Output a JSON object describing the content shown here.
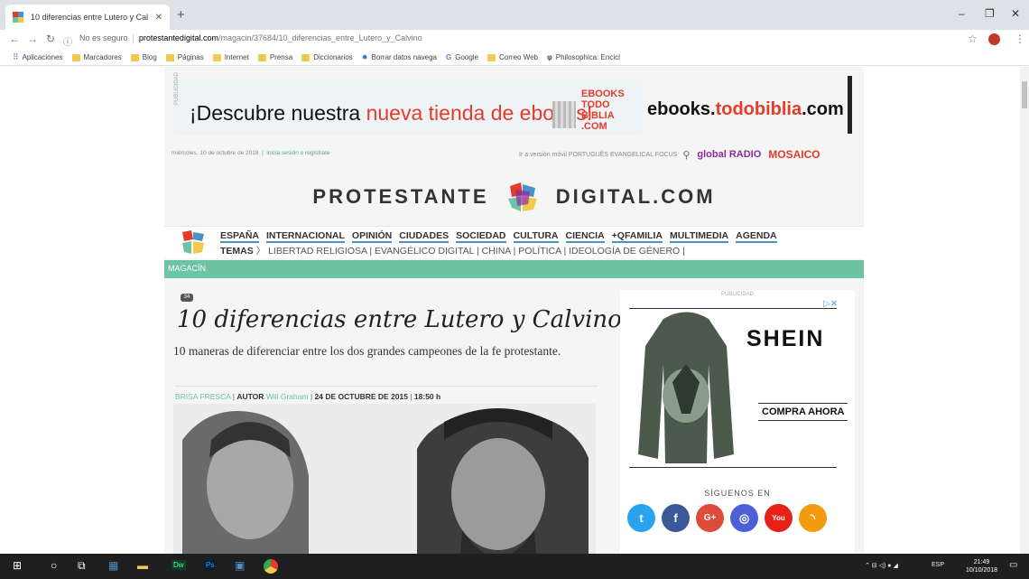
{
  "browser": {
    "tab_title": "10 diferencias entre Lutero y Cal",
    "address_secure": "No es seguro",
    "address_host": "protestantedigital.com",
    "address_path": "/magacin/37684/10_diferencias_entre_Lutero_y_Calvino",
    "bookmarks": [
      "Aplicaciones",
      "Marcadores",
      "Blog",
      "Páginas",
      "Internet",
      "Prensa",
      "Diccionarios",
      "Borrar datos navega",
      "Google",
      "Correo Web",
      "Philosophica: Encicl"
    ]
  },
  "banner": {
    "publicidad": "PUBLICIDAD",
    "text_start": "¡Descubre nuestra ",
    "text_red": "nueva tienda de ebooks!",
    "todobiblia": "EBOOKS TODO BIBLIA .COM",
    "url_black": "ebooks.",
    "url_red": "todobiblia",
    "url_end": ".com"
  },
  "meta": {
    "date": "miércoles, 10 de octubre de 2018",
    "login": "inicia sesión o regístrate",
    "right_links": "Ir a versión móvil   PORTUGUÊS   EVANGELICAL FOCUS",
    "global": "global RADIO",
    "mosaico": "MOSAICO"
  },
  "logo": {
    "left": "PROTESTANTE",
    "right": "DIGITAL.COM"
  },
  "menu": {
    "items": [
      "ESPAÑA",
      "INTERNACIONAL",
      "OPINIÓN",
      "CIUDADES",
      "SOCIEDAD",
      "CULTURA",
      "CIENCIA",
      "+QFAMILIA",
      "MULTIMEDIA",
      "AGENDA"
    ],
    "temas_label": "TEMAS",
    "temas": "LIBERTAD RELIGIOSA  |  EVANGÉLICO DIGITAL  |  CHINA  |  POLÍTICA  |  IDEOLOGÍA DE GÉNERO  |"
  },
  "section": "MAGACÍN",
  "article": {
    "badge": "34",
    "title": "10 diferencias entre Lutero y Calvino",
    "subtitle": "10 maneras de diferenciar entre los dos grandes campeones de la fe protestante.",
    "section": "BRISA FRESCA",
    "autor_label": "AUTOR",
    "author": "Will Graham",
    "date": "24 DE OCTUBRE DE 2015",
    "time": "18:50 h"
  },
  "sidebar": {
    "publicidad": "PUBLICIDAD",
    "brand": "SHEIN",
    "cta": "COMPRA AHORA",
    "follow": "SÍGUENOS EN",
    "social": [
      "t",
      "f",
      "G+",
      "◎",
      "You",
      "◝"
    ]
  },
  "taskbar": {
    "lang": "ESP",
    "time": "21:49",
    "date": "10/10/2018"
  }
}
